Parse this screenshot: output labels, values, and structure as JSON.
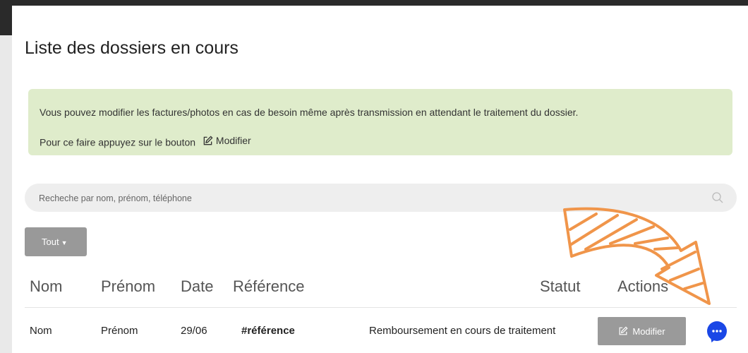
{
  "page": {
    "title": "Liste des dossiers en cours"
  },
  "notice": {
    "line1": "Vous pouvez modifier les factures/photos en cas de besoin même après transmission en attendant le traitement du dossier.",
    "line2": "Pour ce faire appuyez sur le bouton",
    "button_label": "Modifier",
    "background": "#dfeccb"
  },
  "search": {
    "placeholder": "Recheche par nom, prénom, téléphone",
    "icon": "search-icon"
  },
  "filter": {
    "label": "Tout",
    "icon": "caret-down-icon"
  },
  "table": {
    "headers": [
      "Nom",
      "Prénom",
      "Date",
      "Référence",
      "Statut",
      "Actions"
    ],
    "rows": [
      {
        "nom": "Nom",
        "prenom": "Prénom",
        "date": "29/06",
        "reference": "#référence",
        "statut": "Remboursement en cours de traitement",
        "action_label": "Modifier"
      }
    ]
  },
  "chat": {
    "icon": "chat-bubble-icon",
    "color": "#1a47e6"
  },
  "annotation": {
    "icon": "curved-arrow-icon",
    "color": "#f0954a"
  }
}
